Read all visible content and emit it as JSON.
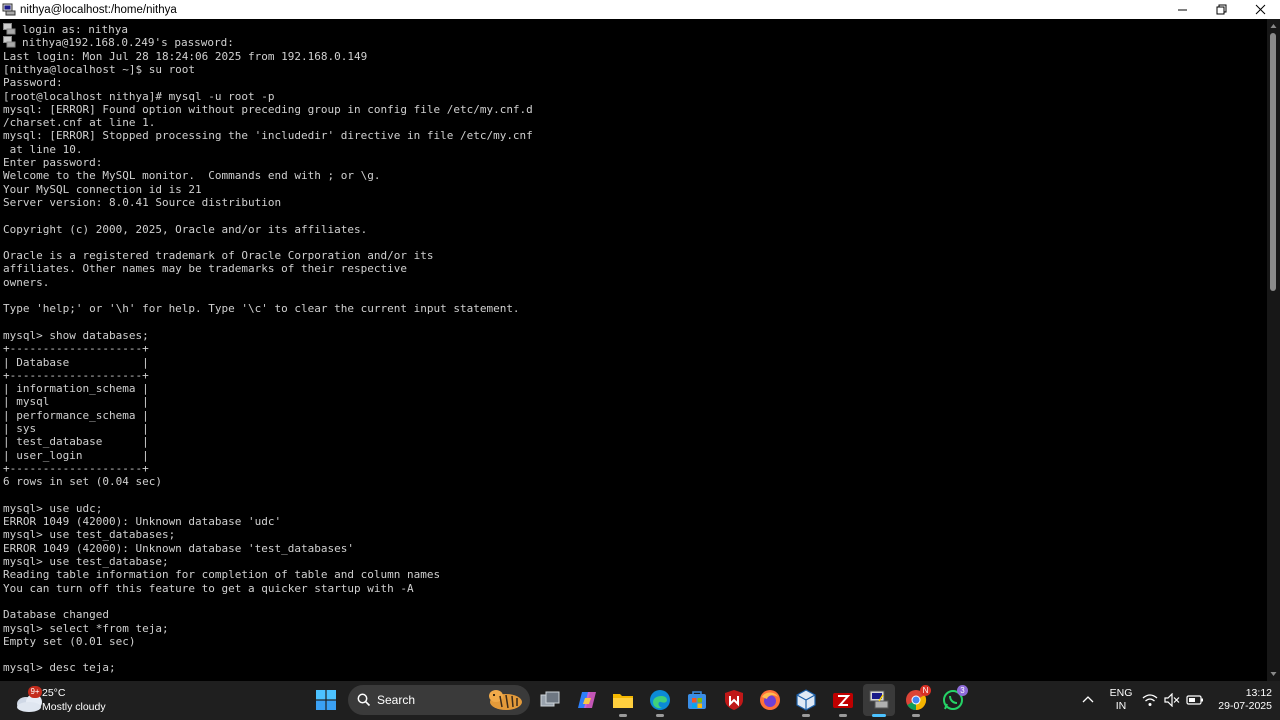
{
  "window": {
    "title": "nithya@localhost:/home/nithya"
  },
  "terminal": {
    "lines": [
      "login as: nithya",
      "nithya@192.168.0.249's password:",
      "Last login: Mon Jul 28 18:24:06 2025 from 192.168.0.149",
      "[nithya@localhost ~]$ su root",
      "Password:",
      "[root@localhost nithya]# mysql -u root -p",
      "mysql: [ERROR] Found option without preceding group in config file /etc/my.cnf.d",
      "/charset.cnf at line 1.",
      "mysql: [ERROR] Stopped processing the 'includedir' directive in file /etc/my.cnf",
      " at line 10.",
      "Enter password:",
      "Welcome to the MySQL monitor.  Commands end with ; or \\g.",
      "Your MySQL connection id is 21",
      "Server version: 8.0.41 Source distribution",
      "",
      "Copyright (c) 2000, 2025, Oracle and/or its affiliates.",
      "",
      "Oracle is a registered trademark of Oracle Corporation and/or its",
      "affiliates. Other names may be trademarks of their respective",
      "owners.",
      "",
      "Type 'help;' or '\\h' for help. Type '\\c' to clear the current input statement.",
      "",
      "mysql> show databases;",
      "+--------------------+",
      "| Database           |",
      "+--------------------+",
      "| information_schema |",
      "| mysql              |",
      "| performance_schema |",
      "| sys                |",
      "| test_database      |",
      "| user_login         |",
      "+--------------------+",
      "6 rows in set (0.04 sec)",
      "",
      "mysql> use udc;",
      "ERROR 1049 (42000): Unknown database 'udc'",
      "mysql> use test_databases;",
      "ERROR 1049 (42000): Unknown database 'test_databases'",
      "mysql> use test_database;",
      "Reading table information for completion of table and column names",
      "You can turn off this feature to get a quicker startup with -A",
      "",
      "Database changed",
      "mysql> select *from teja;",
      "Empty set (0.01 sec)",
      "",
      "mysql> desc teja;"
    ]
  },
  "taskbar": {
    "weather": {
      "temp": "25°C",
      "condition": "Mostly cloudy",
      "badge": "9+"
    },
    "search_label": "Search",
    "lang_top": "ENG",
    "lang_bottom": "IN",
    "time": "13:12",
    "date": "29-07-2025",
    "badges": {
      "chrome": "N",
      "whatsapp": "3"
    },
    "apps": [
      "windows-start",
      "search",
      "task-view",
      "copilot",
      "file-explorer",
      "edge",
      "microsoft-store",
      "mcafee",
      "firefox",
      "virtualbox",
      "filezilla",
      "putty",
      "chrome",
      "whatsapp"
    ]
  },
  "colors": {
    "terminal_bg": "#000000",
    "terminal_fg": "#d0d0d0",
    "taskbar_bg": "#1f1f1f",
    "accent": "#0078d4"
  }
}
